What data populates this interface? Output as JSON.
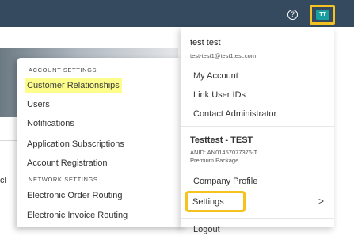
{
  "header": {
    "help_icon": "question-circle-icon",
    "avatar_initials": "TT",
    "avatar_color": "#18a0a0",
    "bar_color": "#354a5f"
  },
  "background": {
    "partial_text": "cl"
  },
  "left_menu": {
    "account_settings_heading": "ACCOUNT SETTINGS",
    "account_items": [
      "Customer Relationships",
      "Users",
      "Notifications",
      "Application Subscriptions",
      "Account Registration"
    ],
    "network_settings_heading": "NETWORK SETTINGS",
    "network_items": [
      "Electronic Order Routing",
      "Electronic Invoice Routing"
    ]
  },
  "user_menu": {
    "name": "test test",
    "email": "test-test1@test1test.com",
    "items": [
      "My Account",
      "Link User IDs",
      "Contact Administrator"
    ],
    "company_name": "Testtest - TEST",
    "anid": "ANID: AN01457077376-T",
    "package": "Premium Package",
    "company_profile": "Company Profile",
    "settings": "Settings",
    "settings_chevron": ">",
    "logout": "Logout"
  },
  "highlight_color": "#f4c320"
}
